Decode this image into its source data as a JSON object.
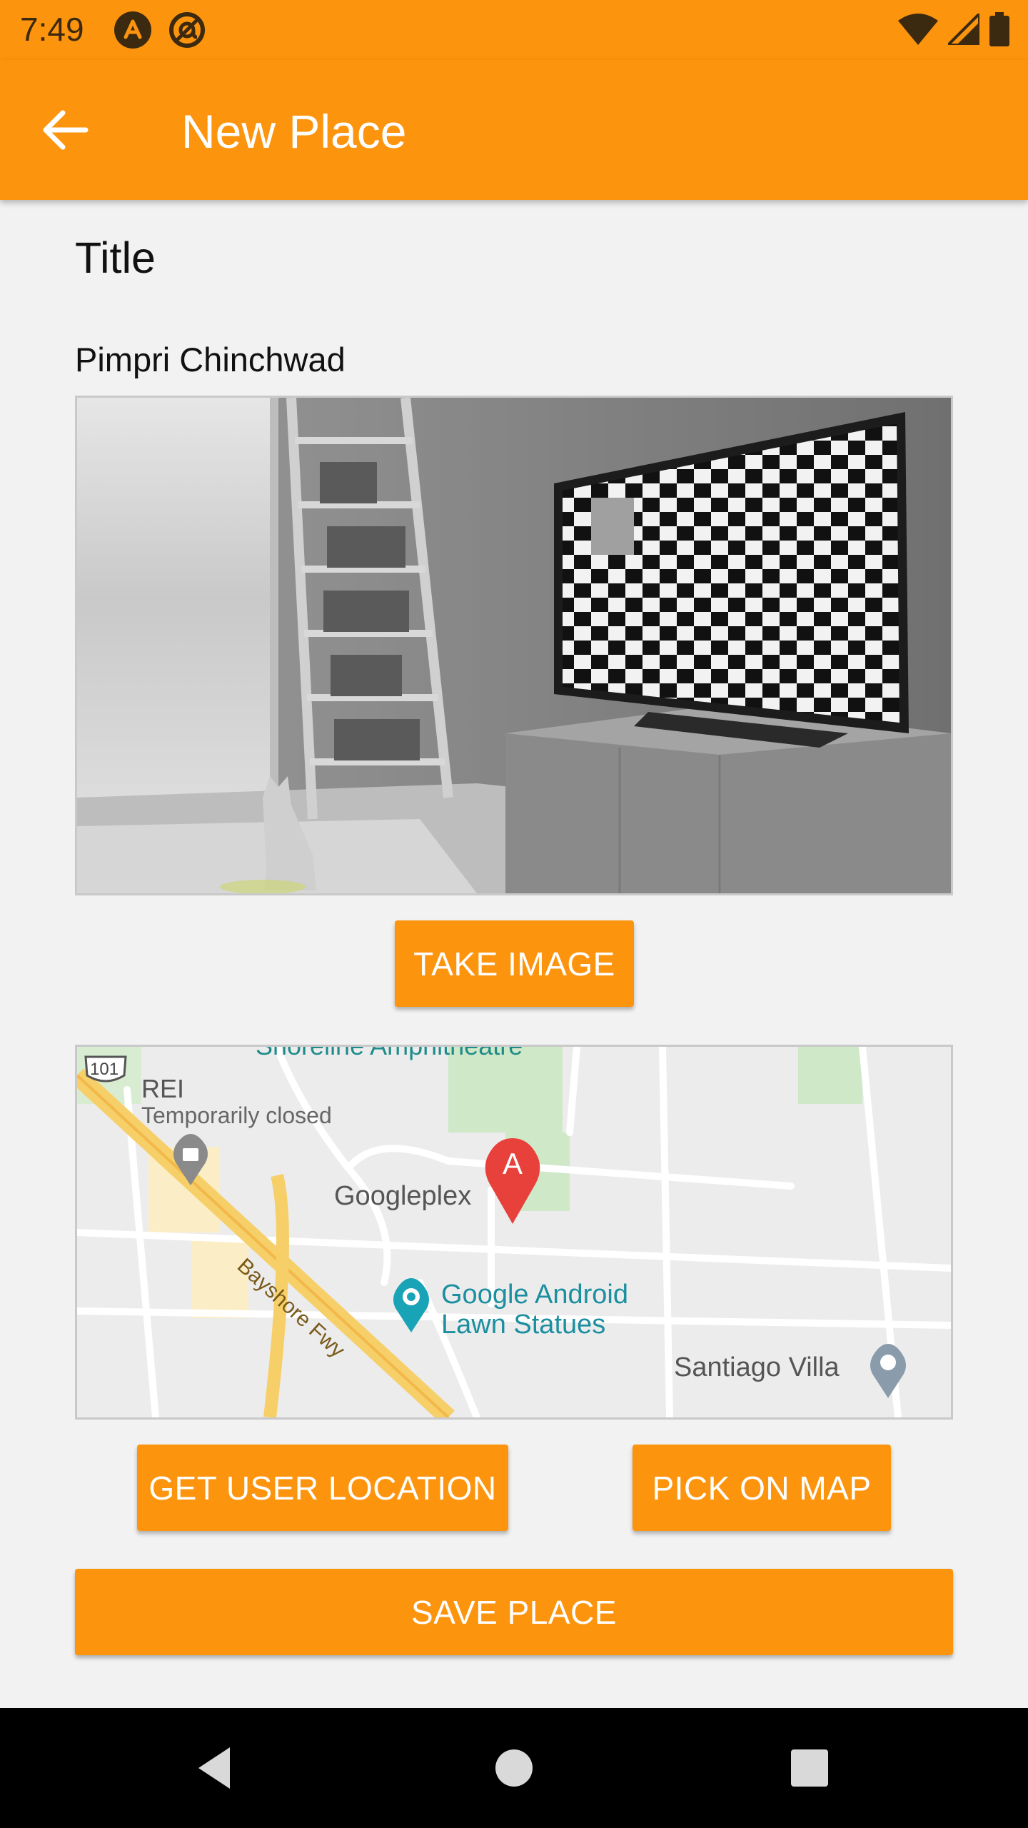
{
  "status_bar": {
    "time": "7:49",
    "icons_left": [
      "app-a-icon",
      "at-icon"
    ],
    "icons_right": [
      "wifi-icon",
      "signal-icon",
      "battery-icon"
    ]
  },
  "app_bar": {
    "title": "New Place",
    "back_icon": "arrow-back-icon"
  },
  "form": {
    "title_label": "Title",
    "title_value": "Pimpri Chinchwad"
  },
  "buttons": {
    "take_image": "TAKE IMAGE",
    "get_user_location": "GET USER LOCATION",
    "pick_on_map": "PICK ON MAP",
    "save_place": "SAVE PLACE"
  },
  "map": {
    "labels": {
      "highway": "101",
      "rei": "REI",
      "rei_status": "Temporarily closed",
      "googleplex": "Googleplex",
      "bayshore": "Bayshore Fwy",
      "android_statues_1": "Google Android",
      "android_statues_2": "Lawn Statues",
      "santiago": "Santiago Villa",
      "amphitheatre": "Shoreline Amphitheatre",
      "marker": "A"
    }
  },
  "nav_bar": {
    "icons": [
      "nav-back-icon",
      "nav-home-icon",
      "nav-recents-icon"
    ]
  },
  "colors": {
    "accent": "#fd940d",
    "background": "#f2f2f2",
    "text": "#111111"
  }
}
